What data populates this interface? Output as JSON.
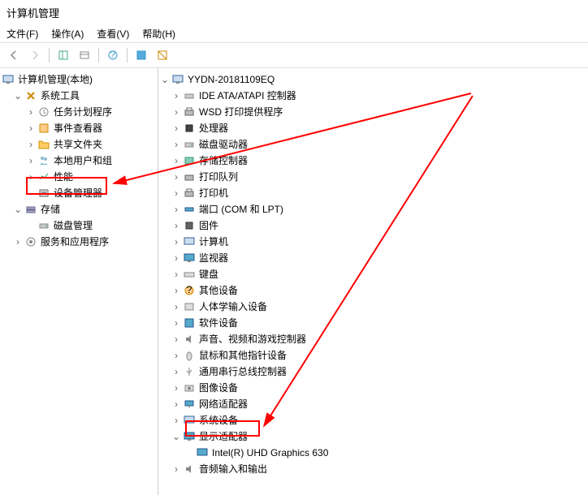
{
  "window": {
    "title": "计算机管理"
  },
  "menu": {
    "file": "文件(F)",
    "action": "操作(A)",
    "view": "查看(V)",
    "help": "帮助(H)"
  },
  "left_tree": {
    "root": "计算机管理(本地)",
    "system_tools": "系统工具",
    "task_scheduler": "任务计划程序",
    "event_viewer": "事件查看器",
    "shared_folders": "共享文件夹",
    "local_users": "本地用户和组",
    "performance": "性能",
    "device_manager": "设备管理器",
    "storage": "存储",
    "disk_management": "磁盘管理",
    "services": "服务和应用程序"
  },
  "right_tree": {
    "root": "YYDN-20181109EQ",
    "ide": "IDE ATA/ATAPI 控制器",
    "wsd": "WSD 打印提供程序",
    "cpu": "处理器",
    "disk_drives": "磁盘驱动器",
    "storage_ctrl": "存储控制器",
    "print_queue": "打印队列",
    "printers": "打印机",
    "ports": "端口 (COM 和 LPT)",
    "firmware": "固件",
    "computer": "计算机",
    "monitors": "监视器",
    "keyboards": "键盘",
    "other_devices": "其他设备",
    "hid": "人体学输入设备",
    "software_devices": "软件设备",
    "sound": "声音、视频和游戏控制器",
    "mouse": "鼠标和其他指针设备",
    "usb": "通用串行总线控制器",
    "imaging": "图像设备",
    "network": "网络适配器",
    "system_devices": "系统设备",
    "display": "显示适配器",
    "display_item": "Intel(R) UHD Graphics 630",
    "audio": "音频输入和输出"
  }
}
